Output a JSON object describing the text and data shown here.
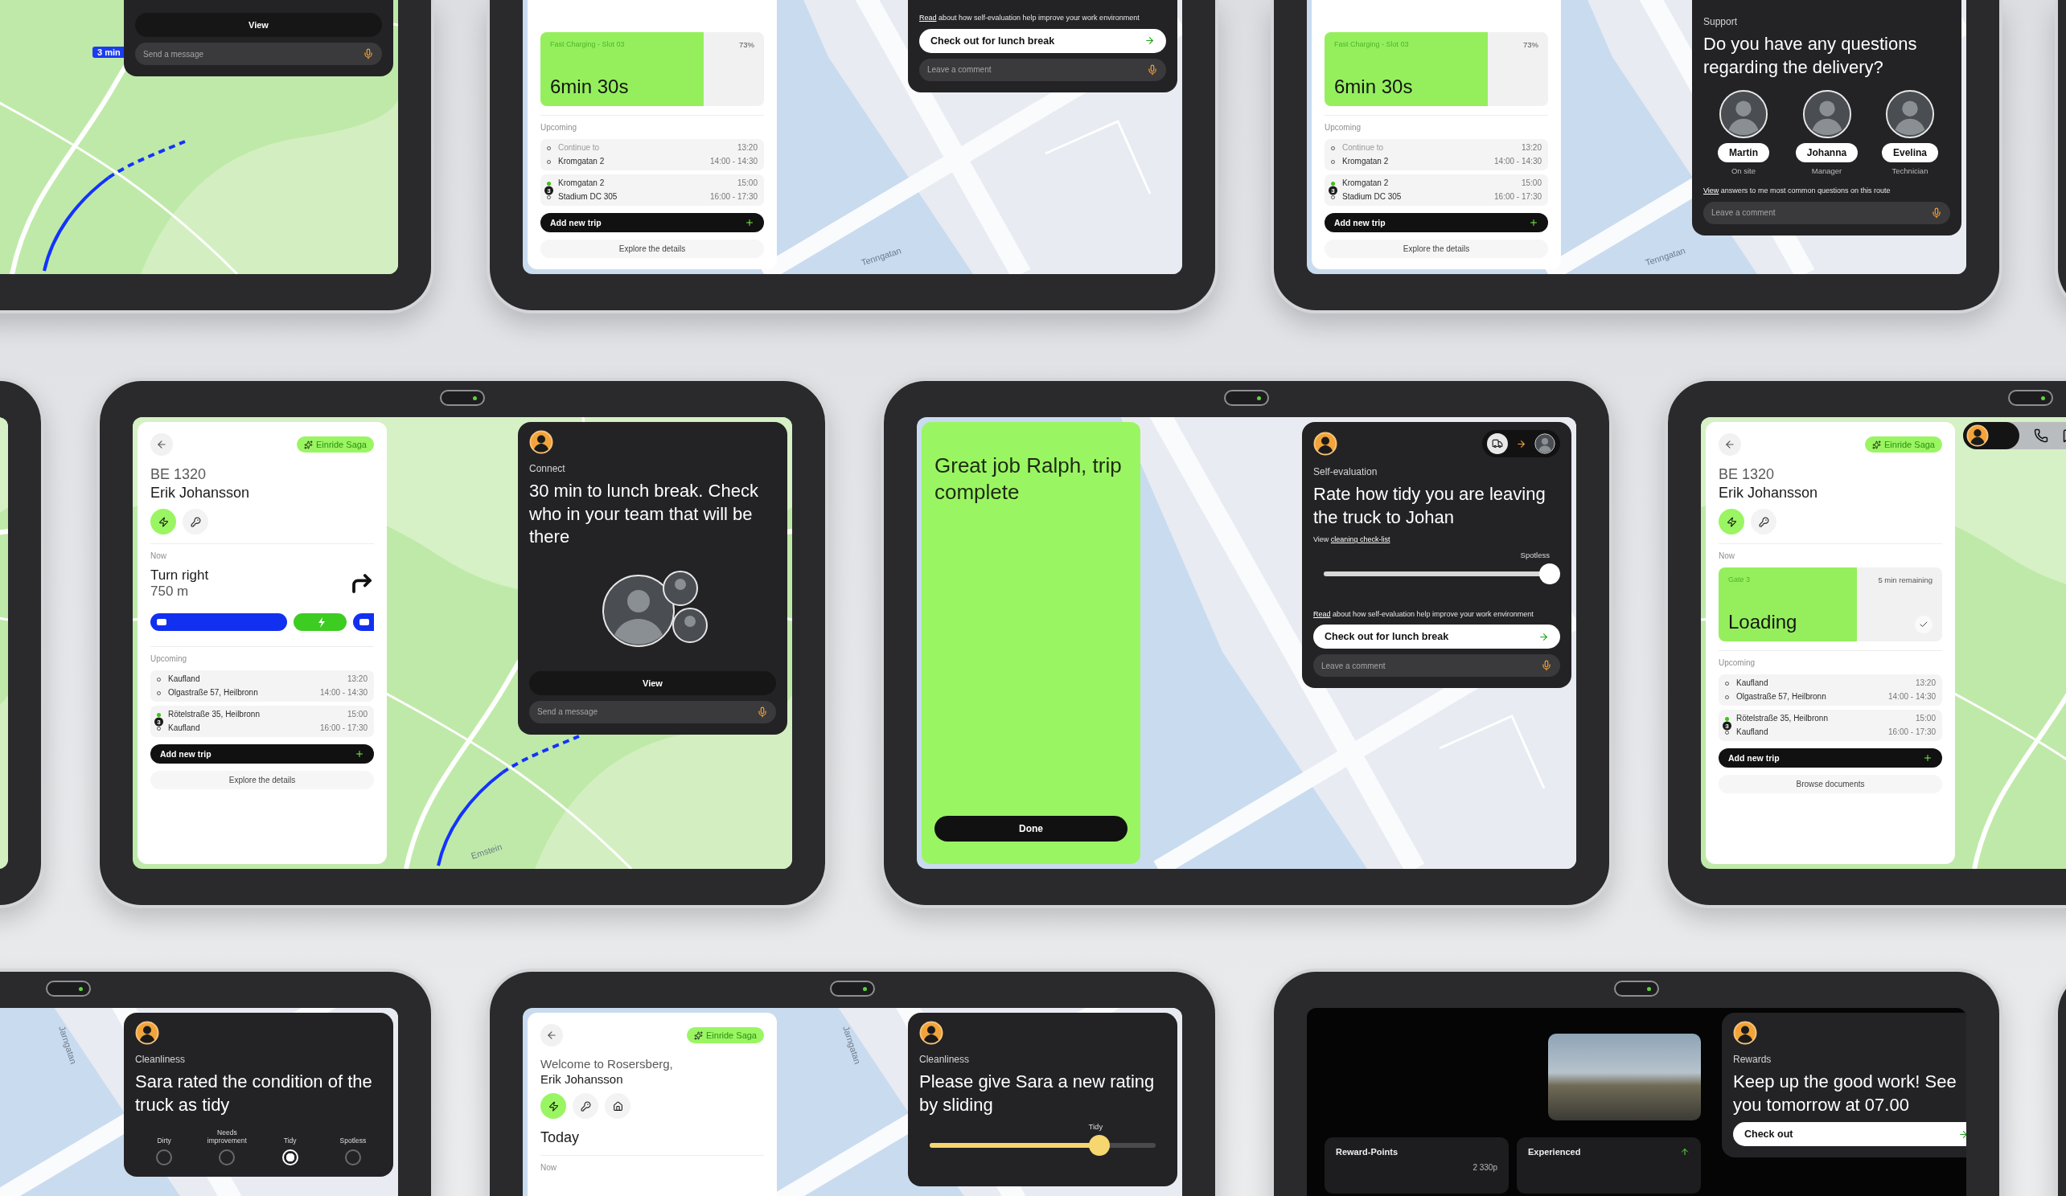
{
  "rows": [
    {
      "tablets": [
        {
          "kind": "green_map",
          "map": {
            "route": true,
            "route_badge": "3 min"
          },
          "card": {
            "blocks": [
              {
                "kind": "view",
                "text": "View"
              },
              {
                "kind": "field",
                "placeholder": "Send a message"
              }
            ]
          }
        },
        {
          "kind": "blue_map",
          "map": {
            "labels": [
              "Tenngatan"
            ]
          },
          "panel": {
            "kind": "light",
            "blocks": [
              {
                "kind": "status",
                "label": "Fast Charging - Slot 03",
                "note": "73%",
                "title": "6min 30s",
                "level": 0.73
              },
              {
                "kind": "label",
                "text": "Upcoming"
              },
              {
                "kind": "trips",
                "groups": [
                  {
                    "stops": [
                      {
                        "name": "Continue to",
                        "time": "13:20",
                        "muted": true
                      },
                      {
                        "name": "Kromgatan 2",
                        "time": "14:00 - 14:30"
                      }
                    ]
                  },
                  {
                    "badge": "3",
                    "stops": [
                      {
                        "name": "Kromgatan 2",
                        "time": "15:00"
                      },
                      {
                        "name": "Stadium DC 305",
                        "time": "16:00 - 17:30"
                      }
                    ]
                  }
                ]
              },
              {
                "kind": "primary",
                "text": "Add new trip"
              },
              {
                "kind": "secondary",
                "text": "Explore the details"
              }
            ]
          },
          "card": {
            "blocks": [
              {
                "kind": "note",
                "parts": [
                  {
                    "text": "Read",
                    "link": true
                  },
                  {
                    "text": " about how self-evaluation help improve your work environment"
                  }
                ]
              },
              {
                "kind": "action",
                "text": "Check out for lunch break"
              },
              {
                "kind": "field",
                "placeholder": "Leave a comment"
              }
            ]
          }
        },
        {
          "kind": "blue_map",
          "map": {
            "labels": [
              "Tenngatan"
            ]
          },
          "panel": {
            "kind": "light",
            "blocks": [
              {
                "kind": "status",
                "label": "Fast Charging - Slot 03",
                "note": "73%",
                "title": "6min 30s",
                "level": 0.73
              },
              {
                "kind": "label",
                "text": "Upcoming"
              },
              {
                "kind": "trips",
                "groups": [
                  {
                    "stops": [
                      {
                        "name": "Continue to",
                        "time": "13:20",
                        "muted": true
                      },
                      {
                        "name": "Kromgatan 2",
                        "time": "14:00 - 14:30"
                      }
                    ]
                  },
                  {
                    "badge": "3",
                    "stops": [
                      {
                        "name": "Kromgatan 2",
                        "time": "15:00"
                      },
                      {
                        "name": "Stadium DC 305",
                        "time": "16:00 - 17:30"
                      }
                    ]
                  }
                ]
              },
              {
                "kind": "primary",
                "text": "Add new trip"
              },
              {
                "kind": "secondary",
                "text": "Explore the details"
              }
            ]
          },
          "card": {
            "blocks": [
              {
                "kind": "eyebrow",
                "text": "Support"
              },
              {
                "kind": "title",
                "text": "Do you have any questions regarding the delivery?"
              },
              {
                "kind": "people",
                "people": [
                  {
                    "name": "Martin",
                    "role": "On site"
                  },
                  {
                    "name": "Johanna",
                    "role": "Manager"
                  },
                  {
                    "name": "Evelina",
                    "role": "Technician"
                  }
                ]
              },
              {
                "kind": "note",
                "parts": [
                  {
                    "text": "View",
                    "link": true
                  },
                  {
                    "text": " answers to me most common questions on this route"
                  }
                ]
              },
              {
                "kind": "field",
                "placeholder": "Leave a comment"
              }
            ]
          }
        },
        {
          "kind": "blue_map"
        }
      ]
    },
    {
      "tablets": [
        {
          "kind": "green_map"
        },
        {
          "kind": "green_map",
          "map": {
            "labels": [
              "Emstein"
            ],
            "route": true
          },
          "panel": {
            "kind": "light",
            "blocks": [
              {
                "kind": "header",
                "tag": "Einride Saga",
                "line1": "BE 1320",
                "line2": "Erik Johansson",
                "icons": [
                  {
                    "kind": "bolt",
                    "active": true
                  },
                  {
                    "kind": "key",
                    "active": false
                  }
                ]
              },
              {
                "kind": "label",
                "text": "Now"
              },
              {
                "kind": "direction",
                "title": "Turn right",
                "distance": "750 m"
              },
              {
                "kind": "timeline"
              },
              {
                "kind": "label",
                "text": "Upcoming"
              },
              {
                "kind": "trips",
                "groups": [
                  {
                    "stops": [
                      {
                        "name": "Kaufland",
                        "time": "13:20"
                      },
                      {
                        "name": "Olgastraße 57, Heilbronn",
                        "time": "14:00 - 14:30"
                      }
                    ]
                  },
                  {
                    "badge": "3",
                    "stops": [
                      {
                        "name": "Rötelstraße 35, Heilbronn",
                        "time": "15:00"
                      },
                      {
                        "name": "Kaufland",
                        "time": "16:00 - 17:30"
                      }
                    ]
                  }
                ]
              },
              {
                "kind": "primary",
                "text": "Add new trip"
              },
              {
                "kind": "secondary",
                "text": "Explore the details"
              }
            ]
          },
          "card": {
            "blocks": [
              {
                "kind": "avatar"
              },
              {
                "kind": "eyebrow",
                "text": "Connect"
              },
              {
                "kind": "title",
                "text": "30 min to lunch break. Check who in your team that will be there"
              },
              {
                "kind": "group_photo"
              },
              {
                "kind": "view",
                "text": "View"
              },
              {
                "kind": "field",
                "placeholder": "Send a message"
              }
            ]
          }
        },
        {
          "kind": "blue_map",
          "panel": {
            "kind": "green",
            "blocks": [
              {
                "kind": "heading",
                "text": "Great job Ralph, trip complete"
              },
              {
                "kind": "done",
                "text": "Done"
              }
            ]
          },
          "card": {
            "blocks": [
              {
                "kind": "avatar",
                "handover": true
              },
              {
                "kind": "eyebrow",
                "text": "Self-evaluation"
              },
              {
                "kind": "title",
                "text": "Rate how tidy you are leaving the truck to Johan"
              },
              {
                "kind": "note",
                "parts": [
                  {
                    "text": "View "
                  },
                  {
                    "text": "cleaning check-list",
                    "link": true
                  }
                ]
              },
              {
                "kind": "slider",
                "label": "Spotless",
                "level": 1
              },
              {
                "kind": "note",
                "parts": [
                  {
                    "text": "Read",
                    "link": true
                  },
                  {
                    "text": " about how self-evaluation help improve your work environment"
                  }
                ]
              },
              {
                "kind": "action",
                "text": "Check out for lunch break"
              },
              {
                "kind": "field",
                "placeholder": "Leave a comment"
              }
            ]
          }
        },
        {
          "kind": "green_map",
          "call_bar": true,
          "panel": {
            "kind": "light",
            "blocks": [
              {
                "kind": "header",
                "tag": "Einride Saga",
                "line1": "BE 1320",
                "line2": "Erik Johansson",
                "icons": [
                  {
                    "kind": "bolt",
                    "active": true
                  },
                  {
                    "kind": "key",
                    "active": false
                  }
                ]
              },
              {
                "kind": "label",
                "text": "Now"
              },
              {
                "kind": "status",
                "label": "Gate 3",
                "note": "5 min remaining",
                "title": "Loading",
                "level": 0.62,
                "done": true
              },
              {
                "kind": "label",
                "text": "Upcoming"
              },
              {
                "kind": "trips",
                "groups": [
                  {
                    "stops": [
                      {
                        "name": "Kaufland",
                        "time": "13:20"
                      },
                      {
                        "name": "Olgastraße 57, Heilbronn",
                        "time": "14:00 - 14:30"
                      }
                    ]
                  },
                  {
                    "badge": "3",
                    "stops": [
                      {
                        "name": "Rötelstraße 35, Heilbronn",
                        "time": "15:00"
                      },
                      {
                        "name": "Kaufland",
                        "time": "16:00 - 17:30"
                      }
                    ]
                  }
                ]
              },
              {
                "kind": "primary",
                "text": "Add new trip"
              },
              {
                "kind": "secondary",
                "text": "Browse documents"
              }
            ]
          }
        }
      ]
    },
    {
      "tablets": [
        {
          "kind": "blue_map",
          "map": {
            "labels": [
              "Jarngatan"
            ]
          },
          "card": {
            "blocks": [
              {
                "kind": "avatar"
              },
              {
                "kind": "eyebrow",
                "text": "Cleanliness"
              },
              {
                "kind": "title",
                "text": "Sara rated the condition of the truck as tidy"
              },
              {
                "kind": "options",
                "options": [
                  {
                    "label": "Dirty",
                    "selected": false
                  },
                  {
                    "label": "Needs improvement",
                    "selected": false
                  },
                  {
                    "label": "Tidy",
                    "selected": true
                  },
                  {
                    "label": "Spotless",
                    "selected": false
                  }
                ]
              }
            ]
          }
        },
        {
          "kind": "blue_map",
          "map": {
            "labels": [
              "Jarngatan"
            ]
          },
          "panel": {
            "kind": "light",
            "blocks": [
              {
                "kind": "header",
                "tag": "Einride Saga",
                "line1": "Welcome to Rosersberg,",
                "line2": "Erik Johansson",
                "icons": [
                  {
                    "kind": "bolt",
                    "active": true
                  },
                  {
                    "kind": "key",
                    "active": false
                  },
                  {
                    "kind": "home",
                    "active": false
                  }
                ]
              },
              {
                "kind": "subheading",
                "text": "Today"
              },
              {
                "kind": "label",
                "text": "Now"
              }
            ]
          },
          "card": {
            "blocks": [
              {
                "kind": "avatar"
              },
              {
                "kind": "eyebrow",
                "text": "Cleanliness"
              },
              {
                "kind": "title",
                "text": "Please give Sara a new rating by sliding"
              },
              {
                "kind": "rating_slider",
                "label": "Tidy",
                "level": 0.75
              }
            ]
          }
        },
        {
          "kind": "dark",
          "panel": {
            "kind": "dark",
            "blocks": [
              {
                "kind": "photo"
              },
              {
                "kind": "tiles",
                "tiles": [
                  {
                    "title": "Reward-Points",
                    "value": "2 330p"
                  },
                  {
                    "title": "Experienced",
                    "rising": true
                  }
                ]
              }
            ]
          },
          "card": {
            "blocks": [
              {
                "kind": "avatar"
              },
              {
                "kind": "eyebrow",
                "text": "Rewards"
              },
              {
                "kind": "title",
                "text": "Keep up the good work! See you tomorrow at 07.00"
              },
              {
                "kind": "action",
                "text": "Check out"
              }
            ]
          }
        },
        {
          "kind": "blue_map"
        }
      ]
    }
  ]
}
